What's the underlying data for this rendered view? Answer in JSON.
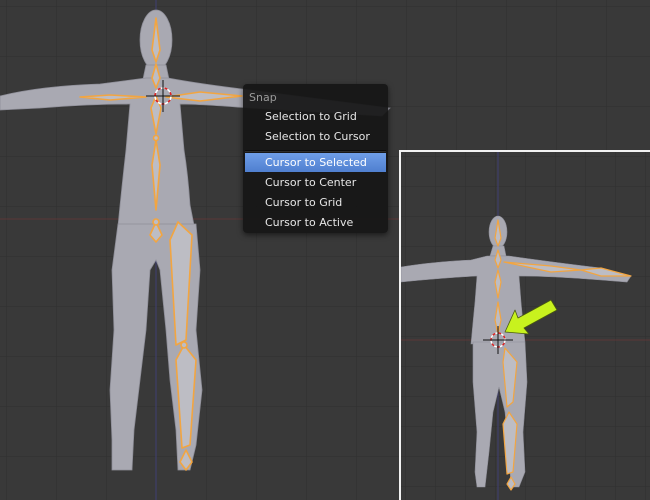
{
  "colors": {
    "viewport_bg": "#393939",
    "grid_line": "#2f2f2f",
    "x_axis": "#6b3a3a",
    "y_axis": "#3f3f73",
    "mesh": "#a9a9b2",
    "bone": "#f2a541",
    "menu_bg": "#161616",
    "menu_highlight": "#5a8ad8",
    "arrow": "#c8f21e"
  },
  "snap_menu": {
    "title": "Snap",
    "items": [
      {
        "label": "Selection to Grid",
        "active": false
      },
      {
        "label": "Selection to Cursor",
        "active": false
      },
      {
        "label": "Cursor to Selected",
        "active": true
      },
      {
        "label": "Cursor to Center",
        "active": false
      },
      {
        "label": "Cursor to Grid",
        "active": false
      },
      {
        "label": "Cursor to Active",
        "active": false
      }
    ]
  },
  "icons": {
    "cursor": "3d-cursor-icon",
    "pointer": "arrow-pointer-icon"
  }
}
